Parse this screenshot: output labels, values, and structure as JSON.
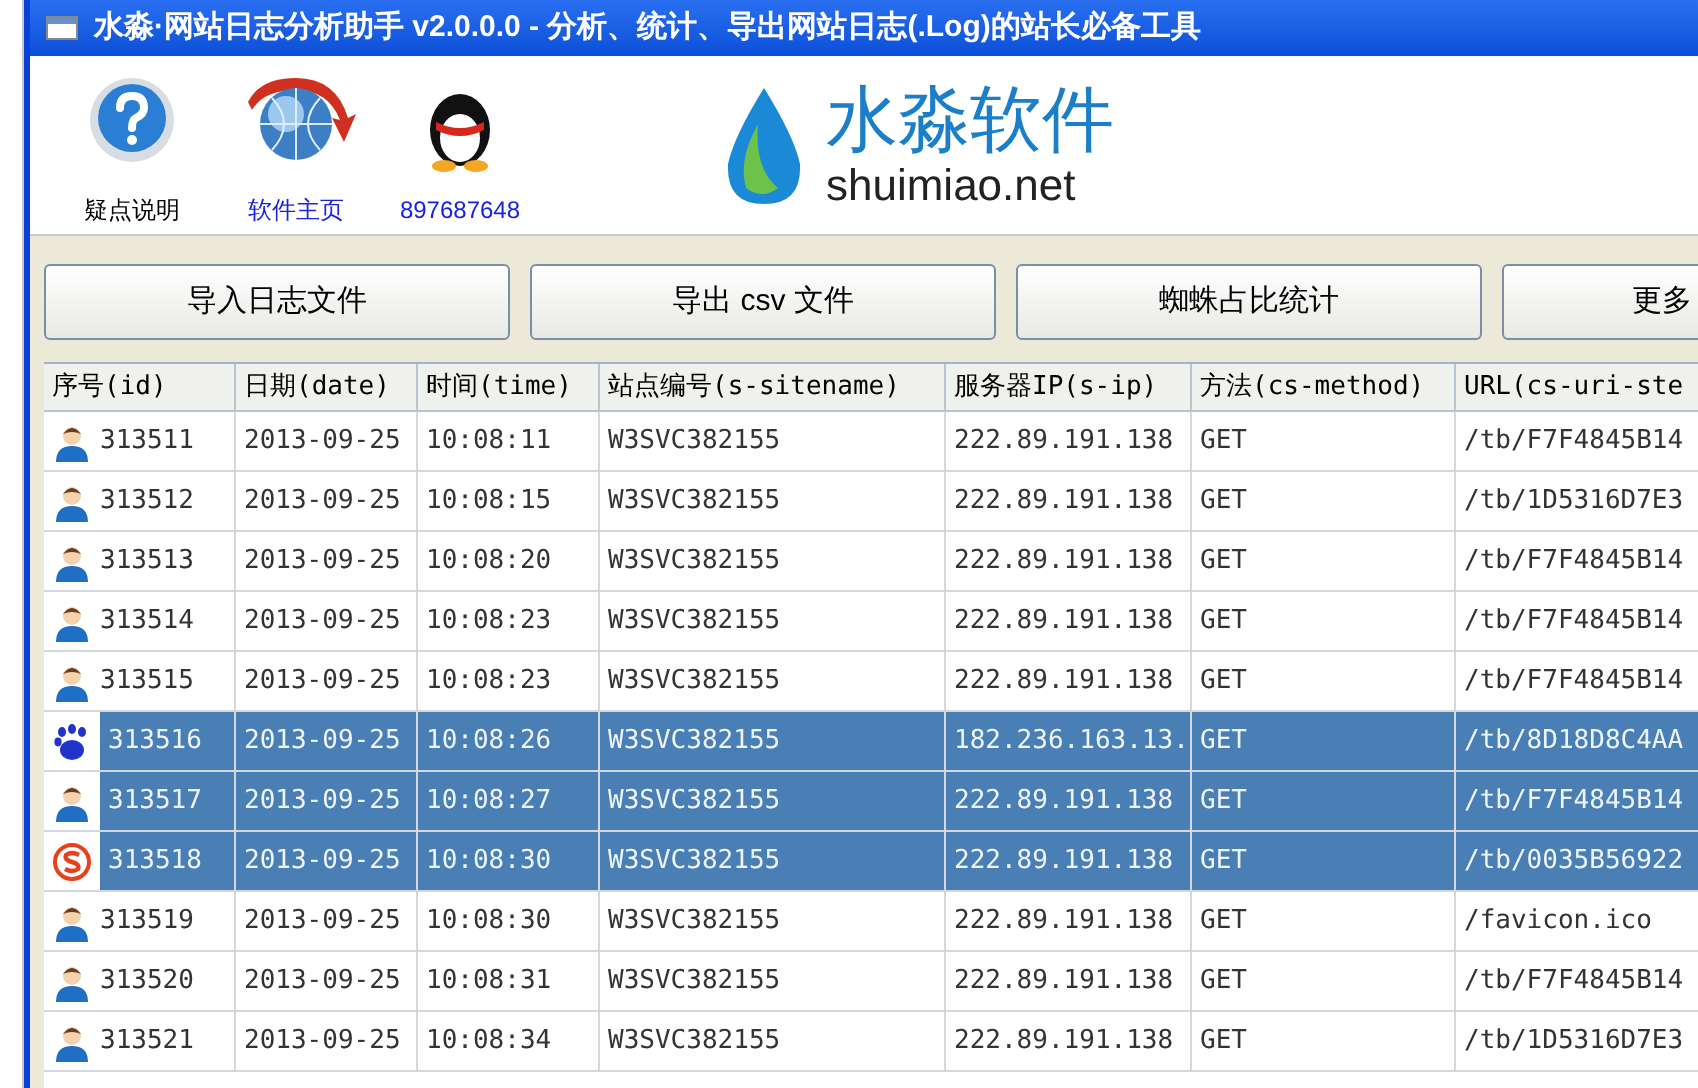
{
  "window": {
    "title": "水淼·网站日志分析助手 v2.0.0.0 - 分析、统计、导出网站日志(.Log)的站长必备工具"
  },
  "toolbar": [
    {
      "kind": "help",
      "label": "疑点说明",
      "link": false
    },
    {
      "kind": "globe",
      "label": "软件主页",
      "link": true
    },
    {
      "kind": "penguin",
      "label": "897687648",
      "link": true
    }
  ],
  "logo": {
    "name": "水淼软件",
    "domain": "shuimiao.net"
  },
  "buttons": [
    "导入日志文件",
    "导出 csv 文件",
    "蜘蛛占比统计",
    "更多"
  ],
  "table": {
    "columns": [
      "序号(id)",
      "日期(date)",
      "时间(time)",
      "站点编号(s-sitename)",
      "服务器IP(s-ip)",
      "方法(cs-method)",
      "URL(cs-uri-ste"
    ],
    "rows": [
      {
        "kind": "user",
        "selected": false,
        "cells": [
          "313511",
          "2013-09-25",
          "10:08:11",
          "W3SVC382155",
          "222.89.191.138",
          "GET",
          "/tb/F7F4845B14"
        ]
      },
      {
        "kind": "user",
        "selected": false,
        "cells": [
          "313512",
          "2013-09-25",
          "10:08:15",
          "W3SVC382155",
          "222.89.191.138",
          "GET",
          "/tb/1D5316D7E3"
        ]
      },
      {
        "kind": "user",
        "selected": false,
        "cells": [
          "313513",
          "2013-09-25",
          "10:08:20",
          "W3SVC382155",
          "222.89.191.138",
          "GET",
          "/tb/F7F4845B14"
        ]
      },
      {
        "kind": "user",
        "selected": false,
        "cells": [
          "313514",
          "2013-09-25",
          "10:08:23",
          "W3SVC382155",
          "222.89.191.138",
          "GET",
          "/tb/F7F4845B14"
        ]
      },
      {
        "kind": "user",
        "selected": false,
        "cells": [
          "313515",
          "2013-09-25",
          "10:08:23",
          "W3SVC382155",
          "222.89.191.138",
          "GET",
          "/tb/F7F4845B14"
        ]
      },
      {
        "kind": "paw",
        "selected": true,
        "cells": [
          "313516",
          "2013-09-25",
          "10:08:26",
          "W3SVC382155",
          "182.236.163.13.",
          "GET",
          "/tb/8D18D8C4AA"
        ]
      },
      {
        "kind": "user",
        "selected": true,
        "cells": [
          "313517",
          "2013-09-25",
          "10:08:27",
          "W3SVC382155",
          "222.89.191.138",
          "GET",
          "/tb/F7F4845B14"
        ]
      },
      {
        "kind": "s",
        "selected": true,
        "cells": [
          "313518",
          "2013-09-25",
          "10:08:30",
          "W3SVC382155",
          "222.89.191.138",
          "GET",
          "/tb/0035B56922"
        ]
      },
      {
        "kind": "user",
        "selected": false,
        "cells": [
          "313519",
          "2013-09-25",
          "10:08:30",
          "W3SVC382155",
          "222.89.191.138",
          "GET",
          "/favicon.ico"
        ]
      },
      {
        "kind": "user",
        "selected": false,
        "cells": [
          "313520",
          "2013-09-25",
          "10:08:31",
          "W3SVC382155",
          "222.89.191.138",
          "GET",
          "/tb/F7F4845B14"
        ]
      },
      {
        "kind": "user",
        "selected": false,
        "cells": [
          "313521",
          "2013-09-25",
          "10:08:34",
          "W3SVC382155",
          "222.89.191.138",
          "GET",
          "/tb/1D5316D7E3"
        ]
      }
    ]
  }
}
